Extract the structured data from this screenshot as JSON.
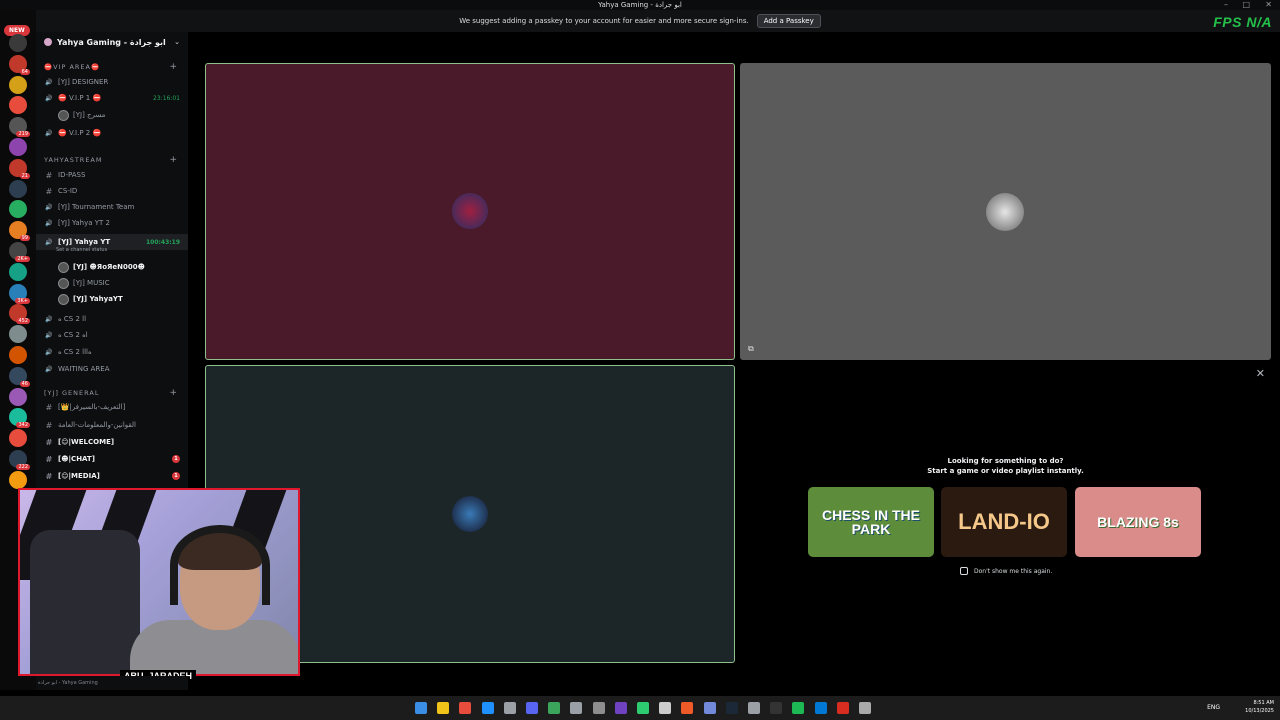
{
  "window": {
    "title": "Yahya Gaming - ابو جرادة"
  },
  "notice": {
    "text": "We suggest adding a passkey to your account for easier and more secure sign-ins.",
    "button": "Add a Passkey"
  },
  "overlay": {
    "fps_label": "FPS",
    "fps_value": "N/A"
  },
  "serverbar": {
    "new_badge": "NEW",
    "badges": [
      "64",
      "219",
      "21",
      "99",
      "2K+",
      "3K+",
      "452",
      "46",
      "342",
      "222",
      "9K+",
      "399"
    ]
  },
  "server": {
    "name": "Yahya Gaming - ابو جرادة"
  },
  "channels": [
    {
      "type": "cat",
      "label": "⛔VIP AREA⛔"
    },
    {
      "type": "voice",
      "label": "[YJ] DESIGNER"
    },
    {
      "type": "voice",
      "label": "⛔ V.I.P 1 ⛔",
      "time": "23:16:01"
    },
    {
      "type": "user",
      "label": "[YJ] ﻣﺴﺮﺝ"
    },
    {
      "type": "voice",
      "label": "⛔ V.I.P 2 ⛔"
    },
    {
      "type": "cat",
      "label": "YAHYASTREAM"
    },
    {
      "type": "text",
      "label": "ID-PASS"
    },
    {
      "type": "text",
      "label": "CS-ID"
    },
    {
      "type": "voice",
      "label": "[YJ] Tournament Team"
    },
    {
      "type": "voice",
      "label": "[YJ] Yahya YT 2"
    },
    {
      "type": "voice",
      "label": "[YJ] Yahya YT",
      "time": "100:43:19"
    },
    {
      "type": "status",
      "label": "Set a channel status"
    },
    {
      "type": "user",
      "label": "[YJ] ☻ЯoЯeN000☻"
    },
    {
      "type": "user",
      "label": "[YJ] MUSIC"
    },
    {
      "type": "user",
      "label": "[YJ] YahyaYT"
    },
    {
      "type": "voice",
      "label": "ه CS 2 اا"
    },
    {
      "type": "voice",
      "label": "ه CS 2 اه"
    },
    {
      "type": "voice",
      "label": "ه CS 2 lllه"
    },
    {
      "type": "voice",
      "label": "WAITING AREA"
    },
    {
      "type": "cat",
      "label": "[YJ] GENERAL"
    },
    {
      "type": "text",
      "label": "[👑|التعريف-بالسيرفر]"
    },
    {
      "type": "text",
      "label": "القوانين-والمعلومات-العامة"
    },
    {
      "type": "text",
      "label": "[☺|WELCOME]",
      "unread": ""
    },
    {
      "type": "text",
      "label": "[☻|CHAT]",
      "unread": "1"
    },
    {
      "type": "text",
      "label": "[☺|MEDIA]",
      "unread": "1"
    }
  ],
  "bottom_user": "ابو جرادة - Yahya Gaming",
  "activity": {
    "line1": "Looking for something to do?",
    "line2": "Start a game or video playlist instantly.",
    "games": [
      {
        "name": "CHESS IN THE PARK"
      },
      {
        "name": "LAND-IO"
      },
      {
        "name": "BLAZING 8s"
      }
    ],
    "checkbox_label": "Don't show me this again."
  },
  "webcam": {
    "name": "ABU_JARADEH"
  },
  "tray": {
    "lang": "ENG",
    "time": "8:51 AM",
    "date": "10/13/2025"
  }
}
